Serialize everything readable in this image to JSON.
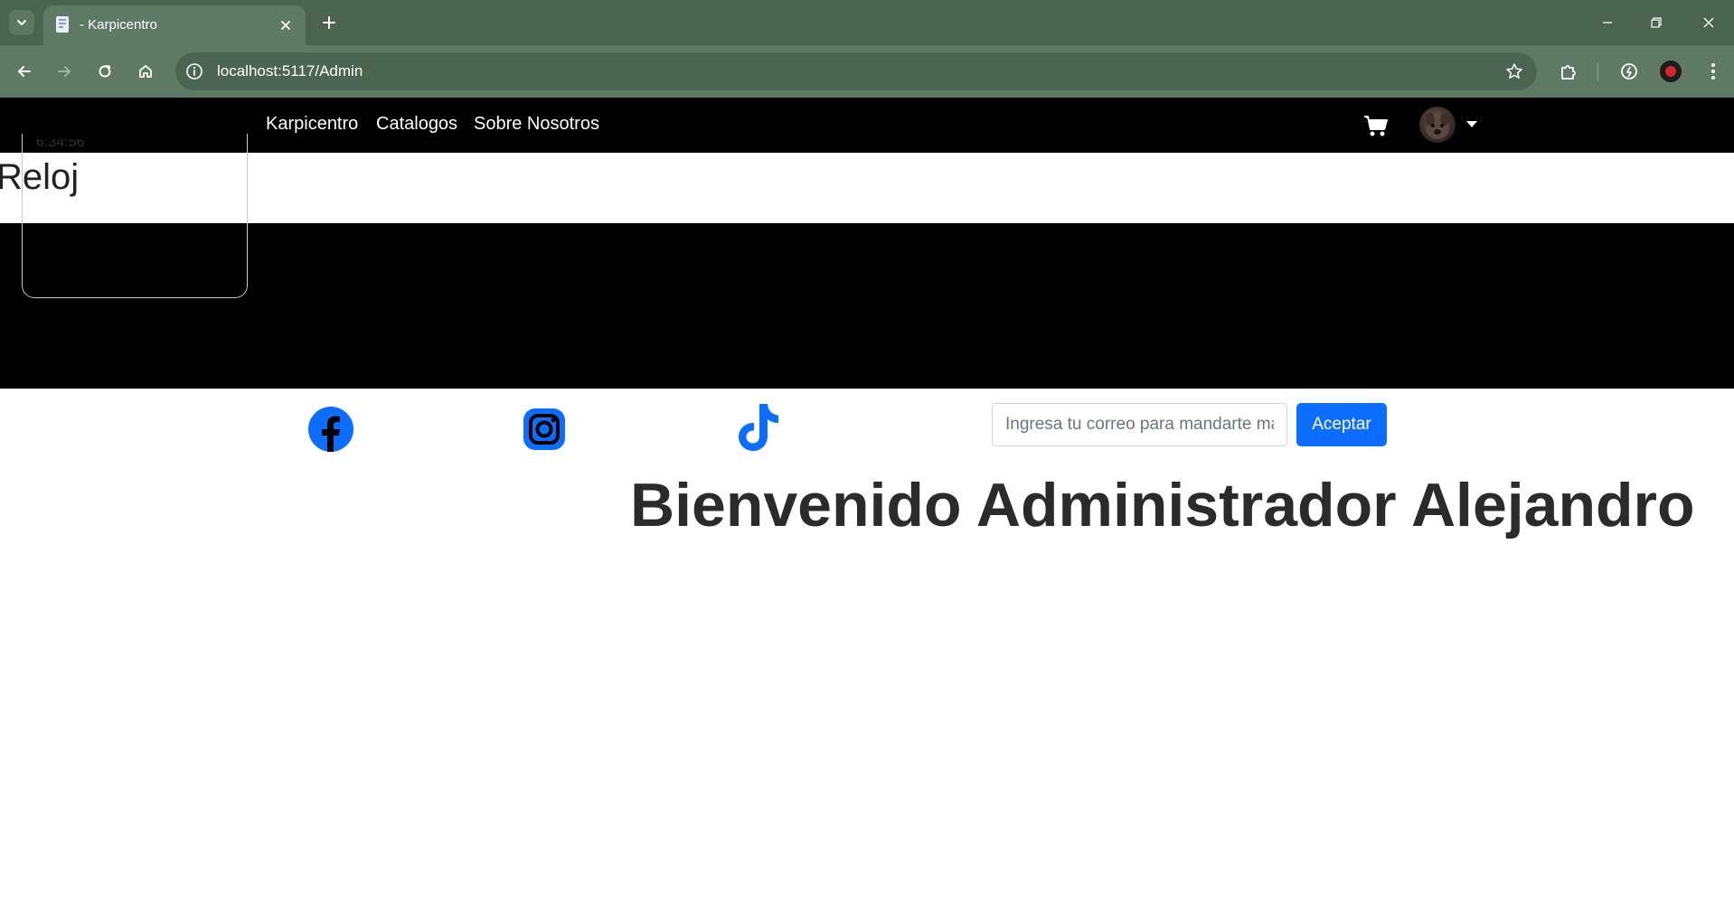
{
  "browser": {
    "tab_title": "- Karpicentro",
    "url": "localhost:5117/Admin"
  },
  "nav": {
    "links": [
      "Karpicentro",
      "Catalogos",
      "Sobre Nosotros"
    ]
  },
  "clock": {
    "time": "6:34:56",
    "title": "Reloj"
  },
  "subscribe": {
    "placeholder": "Ingresa tu correo para mandarte mas ofertas",
    "button_label": "Aceptar"
  },
  "social": [
    "facebook-icon",
    "instagram-icon",
    "tiktok-icon"
  ],
  "welcome": {
    "heading": "Bienvenido Administrador Alejandro"
  },
  "colors": {
    "chrome_frame": "#4a6450",
    "chrome_toolbar": "#5e7a64",
    "site_bar": "#000000",
    "accent": "#0d6efd"
  }
}
